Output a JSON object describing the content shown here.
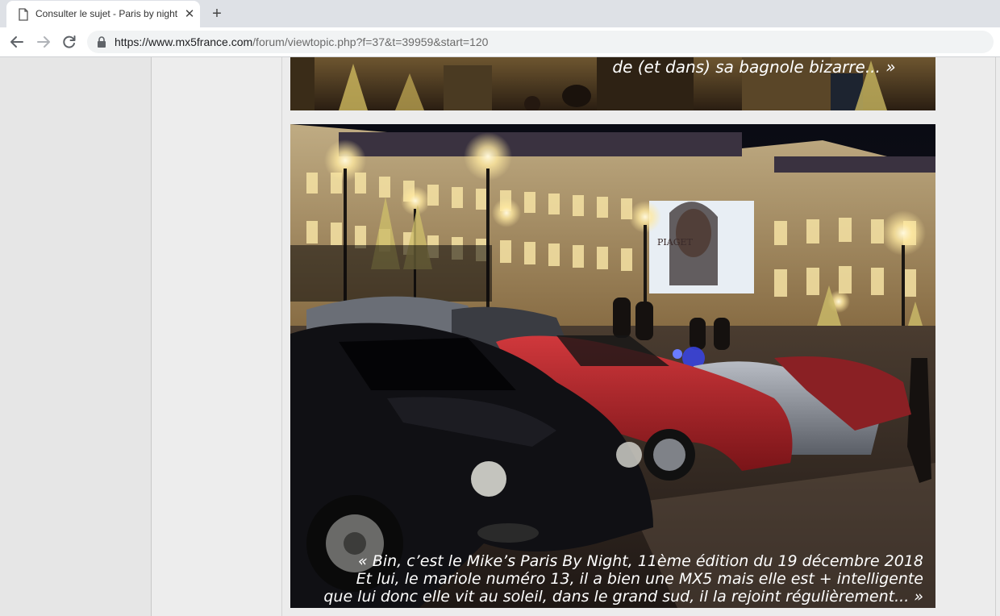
{
  "browser": {
    "tab": {
      "title": "Consulter le sujet - Paris by night",
      "icon": "page-icon",
      "close_label": "✕"
    },
    "new_tab_label": "+",
    "address": {
      "host_part": "https://www.mx5france.com",
      "path_part": "/forum/viewtopic.php?f=37&t=39959&start=120"
    }
  },
  "post": {
    "images": [
      {
        "name": "place-vendome-photo-top",
        "caption": [
          "de (et dans) sa bagnole bizarre... »"
        ]
      },
      {
        "name": "place-vendome-cars-photo",
        "caption": [
          "« Bin, c’est le Mike’s Paris By Night, 11ème édition du 19 décembre 2018",
          "Et lui, le mariole numéro 13, il a bien une MX5 mais elle est + intelligente",
          "que lui donc elle vit au soleil, dans le grand sud, il la rejoint régulièrement... »"
        ]
      }
    ],
    "billboard_text": "PIAGET"
  },
  "colors": {
    "tabstrip": "#dee1e6",
    "toolbar": "#ffffff",
    "omnibox": "#f1f3f4",
    "page_bg": "#ececec",
    "red_car": "#b8262b",
    "black_car": "#101014"
  }
}
